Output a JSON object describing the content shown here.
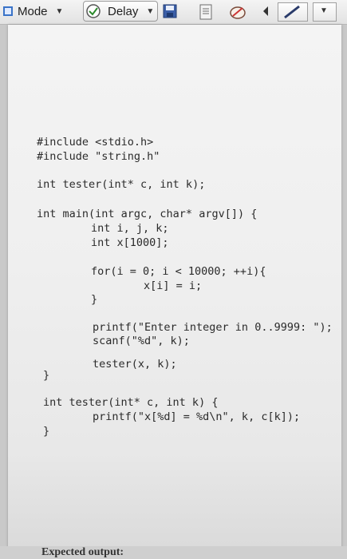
{
  "toolbar": {
    "mode_label": "Mode",
    "delay_label": "Delay"
  },
  "code": {
    "lines": [
      "#include <stdio.h>",
      "#include \"string.h\"",
      "int tester(int* c, int k);",
      "int main(int argc, char* argv[]) {",
      "int i, j, k;",
      "int x[1000];",
      "for(i = 0; i < 10000; ++i){",
      "x[i] = i;",
      "}",
      "printf(\"Enter integer in 0..9999: \");",
      "scanf(\"%d\", k);",
      "tester(x, k);",
      "}",
      "int tester(int* c, int k) {",
      "printf(\"x[%d] = %d\\n\", k, c[k]);",
      "}"
    ]
  },
  "footer": {
    "label": "Expected output:"
  }
}
